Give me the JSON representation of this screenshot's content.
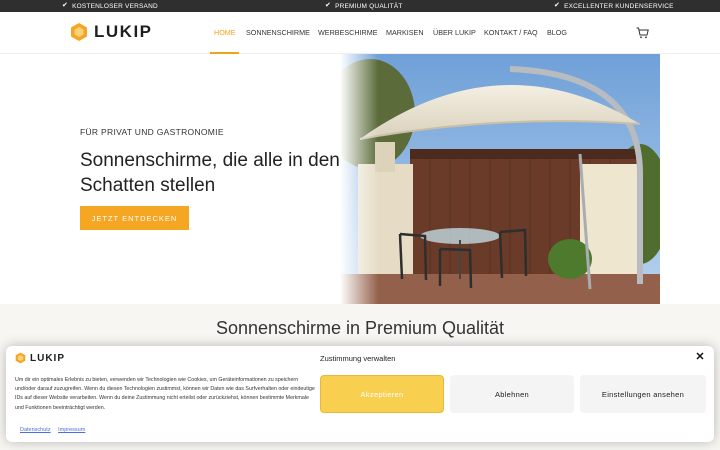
{
  "topbar": {
    "usps": [
      "KOSTENLOSER VERSAND",
      "PREMIUM QUALITÄT",
      "EXCELLENTER KUNDENSERVICE"
    ]
  },
  "header": {
    "logo_text": "LUKIP",
    "nav": [
      "HOME",
      "SONNENSCHIRME",
      "WERBESCHIRME",
      "MARKISEN",
      "ÜBER LUKIP",
      "KONTAKT / FAQ",
      "BLOG"
    ],
    "active_nav": "HOME",
    "cart_icon": "cart-icon"
  },
  "hero": {
    "eyebrow": "FÜR PRIVAT UND GASTRONOMIE",
    "title": "Sonnenschirme, die alle in den Schatten stellen",
    "cta": "JETZT ENTDECKEN"
  },
  "section": {
    "title": "Sonnenschirme in Premium Qualität"
  },
  "cookie": {
    "logo_text": "LUKIP",
    "title": "Zustimmung verwalten",
    "text": "Um dir ein optimales Erlebnis zu bieten, verwenden wir Technologien wie Cookies, um Geräteinformationen zu speichern und/oder darauf zuzugreifen. Wenn du diesen Technologien zustimmst, können wir Daten wie das Surfverhalten oder eindeutige IDs auf dieser Website verarbeiten. Wenn du deine Zustimmung nicht erteilst oder zurückziehst, können bestimmte Merkmale und Funktionen beeinträchtigt werden.",
    "accept": "Akzeptieren",
    "deny": "Ablehnen",
    "settings": "Einstellungen ansehen",
    "links": [
      "Datenschutz",
      "Impressum"
    ]
  },
  "colors": {
    "accent": "#f5a623",
    "accept_button": "#f8cf4f",
    "topbar": "#2f2f2f"
  }
}
